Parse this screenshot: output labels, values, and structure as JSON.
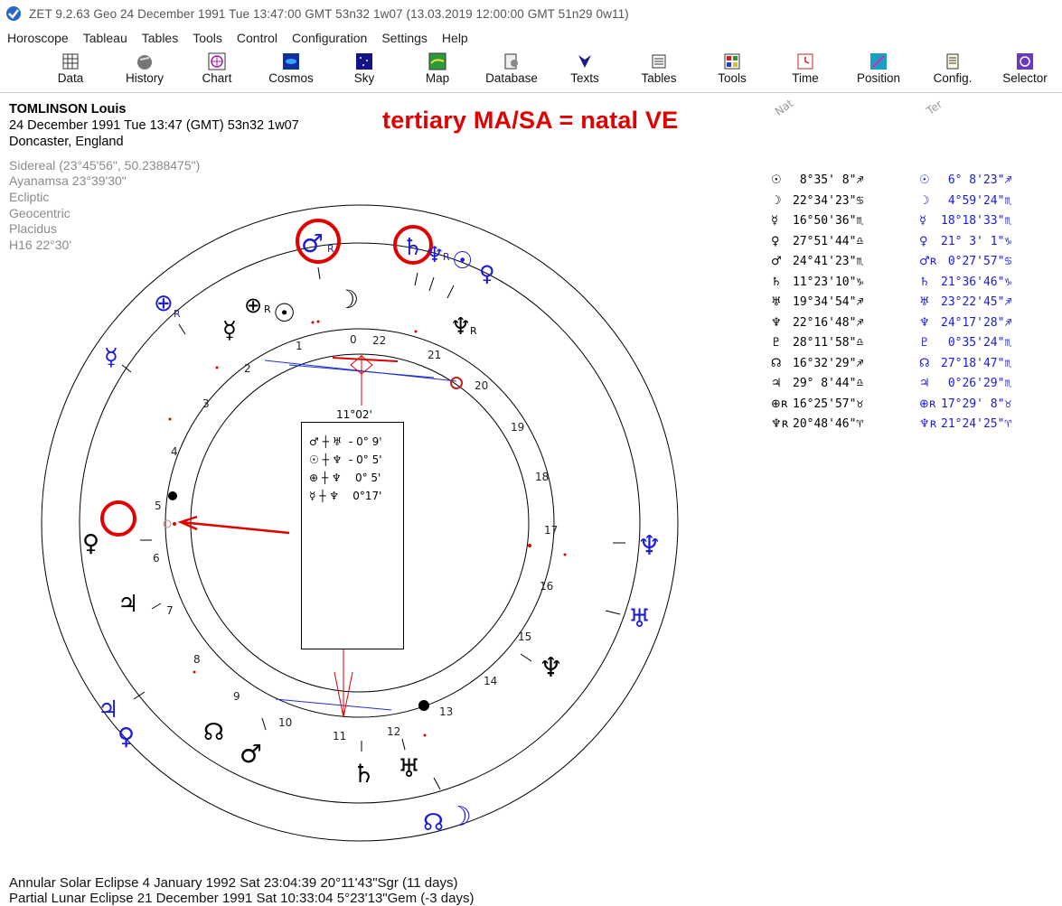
{
  "window": {
    "title": "ZET 9.2.63 Geo    24 December 1991  Tue  13:47:00 GMT 53n32  1w07  (13.03.2019  12:00:00 GMT 51n29 0w11)"
  },
  "menu": [
    "Horoscope",
    "Tableau",
    "Tables",
    "Tools",
    "Control",
    "Configuration",
    "Settings",
    "Help"
  ],
  "toolbar": [
    {
      "label": "Data",
      "icon": "data-grid-icon"
    },
    {
      "label": "History",
      "icon": "history-ball-icon"
    },
    {
      "label": "Chart",
      "icon": "chart-wheel-icon"
    },
    {
      "label": "Cosmos",
      "icon": "cosmos-icon"
    },
    {
      "label": "Sky",
      "icon": "sky-stars-icon"
    },
    {
      "label": "Map",
      "icon": "map-icon"
    },
    {
      "label": "Database",
      "icon": "database-icon"
    },
    {
      "label": "Texts",
      "icon": "texts-icon"
    },
    {
      "label": "Tables",
      "icon": "tables-icon"
    },
    {
      "label": "Tools",
      "icon": "tools-icon"
    },
    {
      "label": "Time",
      "icon": "time-icon"
    },
    {
      "label": "Position",
      "icon": "position-icon"
    },
    {
      "label": "Config.",
      "icon": "config-icon"
    },
    {
      "label": "Selector",
      "icon": "selector-icon"
    }
  ],
  "person": {
    "name": "TOMLINSON Louis",
    "datetime": "24 December 1991  Tue  13:47 (GMT) 53n32  1w07",
    "place": "Doncaster, England"
  },
  "settings": [
    "Sidereal (23°45'56\", 50.2388475\")",
    "Ayanamsa 23°39'30\"",
    "Ecliptic",
    "Geocentric",
    "Placidus",
    "H16  22°30'"
  ],
  "annotation": "tertiary MA/SA = natal VE",
  "positions": {
    "natal_head": "Nat",
    "tertiary_head": "Ter",
    "rows": [
      {
        "nat_sym": "☉",
        "nat": " 8°35' 8\"♐",
        "ter_sym": "☉",
        "ter": " 6° 8'23\"♐"
      },
      {
        "nat_sym": "☽",
        "nat": "22°34'23\"♋",
        "ter_sym": "☽",
        "ter": " 4°59'24\"♏"
      },
      {
        "nat_sym": "☿",
        "nat": "16°50'36\"♏",
        "ter_sym": "☿",
        "ter": "18°18'33\"♏"
      },
      {
        "nat_sym": "♀",
        "nat": "27°51'44\"♎",
        "ter_sym": "♀",
        "ter": "21° 3' 1\"♑"
      },
      {
        "nat_sym": "♂",
        "nat": "24°41'23\"♏",
        "ter_sym": "♂ʀ",
        "ter": " 0°27'57\"♋"
      },
      {
        "nat_sym": "♄",
        "nat": "11°23'10\"♑",
        "ter_sym": "♄",
        "ter": "21°36'46\"♑"
      },
      {
        "nat_sym": "♅",
        "nat": "19°34'54\"♐",
        "ter_sym": "♅",
        "ter": "23°22'45\"♐"
      },
      {
        "nat_sym": "♆",
        "nat": "22°16'48\"♐",
        "ter_sym": "♆",
        "ter": "24°17'28\"♐"
      },
      {
        "nat_sym": "♇",
        "nat": "28°11'58\"♎",
        "ter_sym": "♇",
        "ter": " 0°35'24\"♏"
      },
      {
        "nat_sym": "☊",
        "nat": "16°32'29\"♐",
        "ter_sym": "☊",
        "ter": "27°18'47\"♏"
      },
      {
        "nat_sym": "♃",
        "nat": "29° 8'44\"♎",
        "ter_sym": "♃",
        "ter": " 0°26'29\"♏"
      },
      {
        "nat_sym": "⊕ʀ",
        "nat": "16°25'57\"♉",
        "ter_sym": "⊕ʀ",
        "ter": "17°29' 8\"♉"
      },
      {
        "nat_sym": "♆ʀ",
        "nat": "20°48'46\"♈",
        "ter_sym": "♆ʀ",
        "ter": "21°24'25\"♈"
      }
    ]
  },
  "chart": {
    "house_label": "11°02'",
    "aspects": [
      {
        "p1": "♂",
        "p2": "♅",
        "value": "- 0° 9'"
      },
      {
        "p1": "☉",
        "p2": "♆",
        "value": "- 0° 5'"
      },
      {
        "p1": "⊕",
        "p2": "♆",
        "value": "0° 5'"
      },
      {
        "p1": "☿",
        "p2": "♆",
        "value": "0°17'"
      }
    ]
  },
  "eclipses": [
    "Annular Solar Eclipse 4 January 1992 Sat 23:04:39 20°11'43\"Sgr (11 days)",
    "Partial Lunar Eclipse 21 December 1991 Sat 10:33:04  5°23'13\"Gem (-3 days)"
  ],
  "colors": {
    "accent_red": "#e00000",
    "tertiary_blue": "#1a1adb"
  }
}
